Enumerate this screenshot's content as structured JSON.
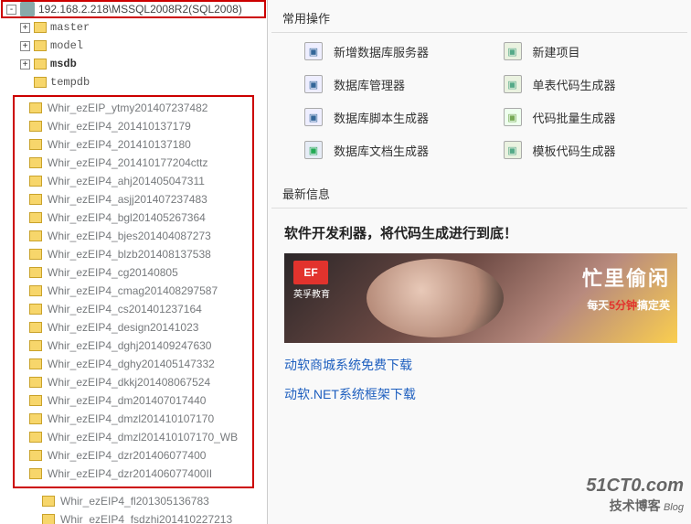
{
  "server": {
    "label": "192.168.2.218\\MSSQL2008R2(SQL2008)"
  },
  "sys_dbs": [
    {
      "name": "master",
      "exp": true
    },
    {
      "name": "model",
      "exp": true
    },
    {
      "name": "msdb",
      "exp": true,
      "bold": true
    },
    {
      "name": "tempdb",
      "exp": false
    }
  ],
  "boxed_dbs": [
    "Whir_ezEIP_ytmy201407237482",
    "Whir_ezEIP4_201410137179",
    "Whir_ezEIP4_201410137180",
    "Whir_ezEIP4_201410177204cttz",
    "Whir_ezEIP4_ahj201405047311",
    "Whir_ezEIP4_asjj201407237483",
    "Whir_ezEIP4_bgl201405267364",
    "Whir_ezEIP4_bjes201404087273",
    "Whir_ezEIP4_blzb201408137538",
    "Whir_ezEIP4_cg20140805",
    "Whir_ezEIP4_cmag201408297587",
    "Whir_ezEIP4_cs201401237164",
    "Whir_ezEIP4_design20141023",
    "Whir_ezEIP4_dghj201409247630",
    "Whir_ezEIP4_dghy201405147332",
    "Whir_ezEIP4_dkkj201408067524",
    "Whir_ezEIP4_dm201407017440",
    "Whir_ezEIP4_dmzl201410107170",
    "Whir_ezEIP4_dmzl201410107170_WB",
    "Whir_ezEIP4_dzr201406077400",
    "Whir_ezEIP4_dzr201406077400II"
  ],
  "tail_dbs": [
    "Whir_ezEIP4_fl201305136783",
    "Whir_ezEIP4_fsdzhi201410227213"
  ],
  "right": {
    "ops_title": "常用操作",
    "ops": [
      {
        "label": "新增数据库服务器",
        "icon": "db"
      },
      {
        "label": "新建项目",
        "icon": "pen"
      },
      {
        "label": "数据库管理器",
        "icon": "db"
      },
      {
        "label": "单表代码生成器",
        "icon": "pen"
      },
      {
        "label": "数据库脚本生成器",
        "icon": "db"
      },
      {
        "label": "代码批量生成器",
        "icon": "dsi"
      },
      {
        "label": "数据库文档生成器",
        "icon": "word"
      },
      {
        "label": "模板代码生成器",
        "icon": "pen"
      }
    ],
    "news_title": "最新信息",
    "headline": "软件开发利器，将代码生成进行到底！",
    "banner": {
      "brand": "EF",
      "brand_sub": "英孚教育",
      "line1": "忙里偷闲",
      "line2_a": "每天",
      "line2_hl": "5分钟",
      "line2_b": "搞定英"
    },
    "links": [
      "动软商城系统免费下载",
      "动软.NET系统框架下载"
    ],
    "watermark": {
      "big": "51CT0.com",
      "sub": "技术博客",
      "blog": "Blog"
    }
  }
}
